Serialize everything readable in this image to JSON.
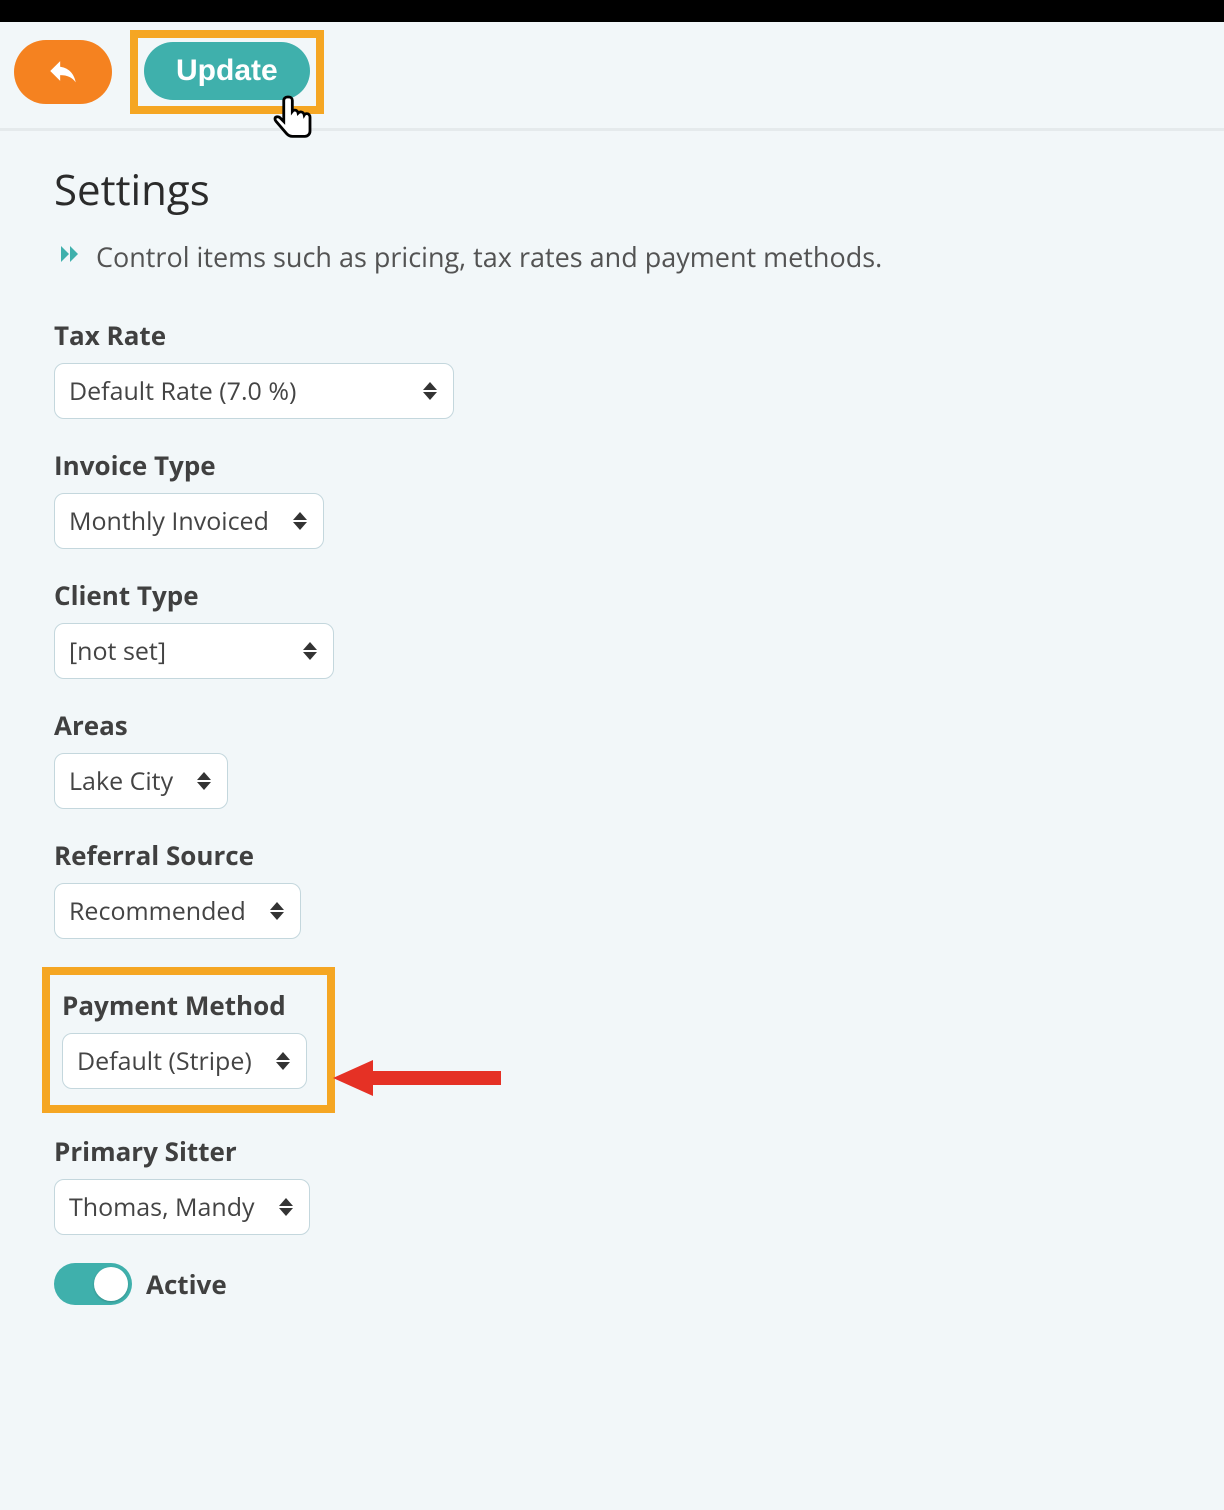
{
  "toolbar": {
    "update_label": "Update"
  },
  "page": {
    "title": "Settings",
    "subtitle": "Control items such as pricing, tax rates and payment methods."
  },
  "fields": {
    "tax_rate": {
      "label": "Tax Rate",
      "value": "Default Rate (7.0 %)"
    },
    "invoice_type": {
      "label": "Invoice Type",
      "value": "Monthly Invoiced"
    },
    "client_type": {
      "label": "Client Type",
      "value": "[not set]"
    },
    "areas": {
      "label": "Areas",
      "value": "Lake City"
    },
    "referral_source": {
      "label": "Referral Source",
      "value": "Recommended"
    },
    "payment_method": {
      "label": "Payment Method",
      "value": "Default (Stripe)"
    },
    "primary_sitter": {
      "label": "Primary Sitter",
      "value": "Thomas, Mandy"
    },
    "active": {
      "label": "Active",
      "on": true
    }
  }
}
